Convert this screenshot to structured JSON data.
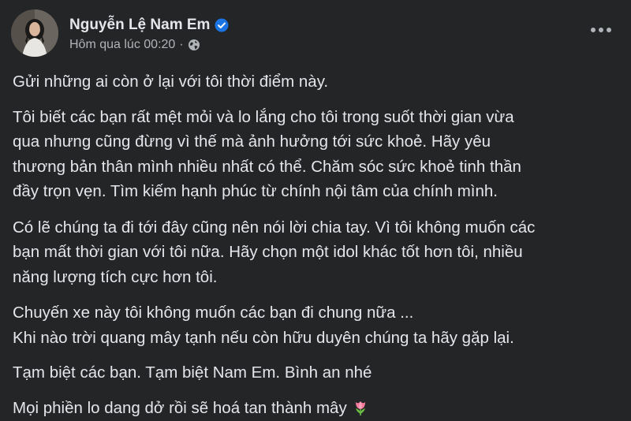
{
  "author": {
    "name": "Nguyễn Lệ Nam Em",
    "verified": true,
    "timestamp": "Hôm qua lúc 00:20",
    "separator": "·",
    "privacy_icon": "globe-icon"
  },
  "header": {
    "more_icon": "more-horizontal-icon"
  },
  "post": {
    "paragraphs": [
      {
        "lines": [
          "Gửi những ai còn ở lại với tôi thời điểm này."
        ]
      },
      {
        "lines": [
          "Tôi biết các bạn rất mệt mỏi và lo lắng cho tôi trong suốt thời gian vừa",
          "qua nhưng cũng đừng vì thế mà ảnh hưởng tới sức khoẻ. Hãy yêu",
          "thương bản thân mình nhiều nhất có thể. Chăm sóc sức khoẻ tinh thần",
          "đầy trọn vẹn. Tìm kiếm hạnh phúc từ chính nội tâm của chính mình."
        ]
      },
      {
        "lines": [
          "Có lẽ chúng ta đi tới đây cũng nên nói lời chia tay. Vì tôi không muốn các",
          "bạn mất thời gian với tôi nữa. Hãy chọn một idol khác tốt hơn tôi, nhiều",
          "năng lượng tích cực hơn tôi."
        ]
      },
      {
        "lines": [
          "Chuyến xe này tôi không muốn các bạn đi chung nữa ...",
          "Khi nào trời quang mây tạnh nếu còn hữu duyên chúng ta hãy gặp lại."
        ]
      },
      {
        "lines": [
          "Tạm biệt các bạn. Tạm biệt Nam Em. Bình an nhé"
        ]
      },
      {
        "lines": [
          "Mọi phiền lo dang dở rồi sẽ hoá tan thành mây"
        ],
        "emoji": "tulip-icon"
      }
    ]
  },
  "colors": {
    "background": "#242526",
    "primary_text": "#e4e6eb",
    "secondary_text": "#b0b3b8",
    "verified_badge": "#1b74e4"
  }
}
